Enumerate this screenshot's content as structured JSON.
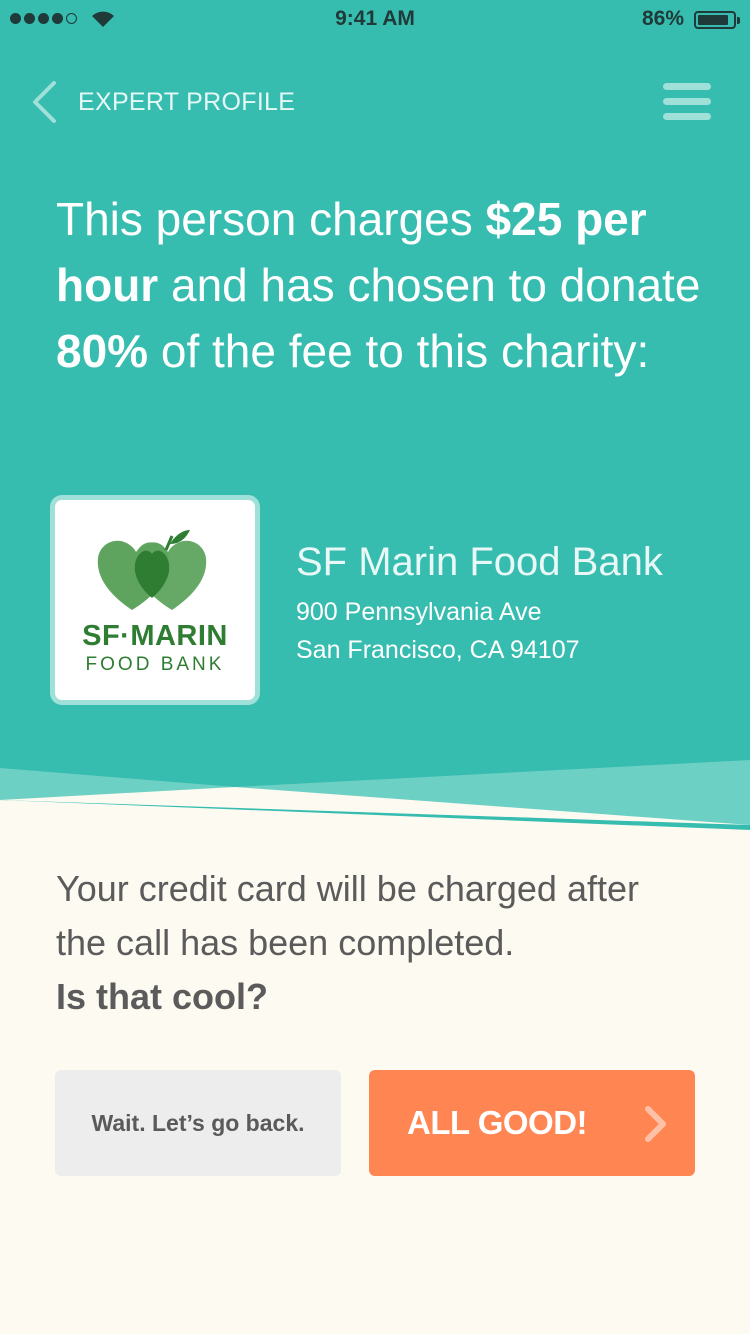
{
  "status_bar": {
    "time": "9:41 AM",
    "battery_percent": "86%",
    "battery_level": 0.86,
    "signal_bars_filled": 4,
    "signal_bars_total": 5
  },
  "nav": {
    "back_label": "EXPERT PROFILE",
    "back_icon": "chevron-left-icon",
    "menu_icon": "hamburger-menu-icon"
  },
  "headline": {
    "p1": "This person charges ",
    "rate": "$25 per hour",
    "p2": " and has chosen to donate ",
    "percent": "80%",
    "p3": " of the fee to this charity:"
  },
  "charity": {
    "logo_line1": "SF·MARIN",
    "logo_line2": "FOOD BANK",
    "name": "SF Marin Food Bank",
    "address_line1": "900 Pennsylvania Ave",
    "address_line2": "San Francisco, CA 94107"
  },
  "confirmation": {
    "text": "Your credit card will be charged after the call has been completed.",
    "question": "Is that cool?"
  },
  "buttons": {
    "back_label": "Wait. Let’s go back.",
    "confirm_label": "ALL GOOD!",
    "confirm_icon": "chevron-right-icon"
  },
  "colors": {
    "header_teal": "#37bcb0",
    "accent_orange": "#ff8552",
    "background_cream": "#fdfaf1",
    "logo_green": "#2e7d32"
  }
}
